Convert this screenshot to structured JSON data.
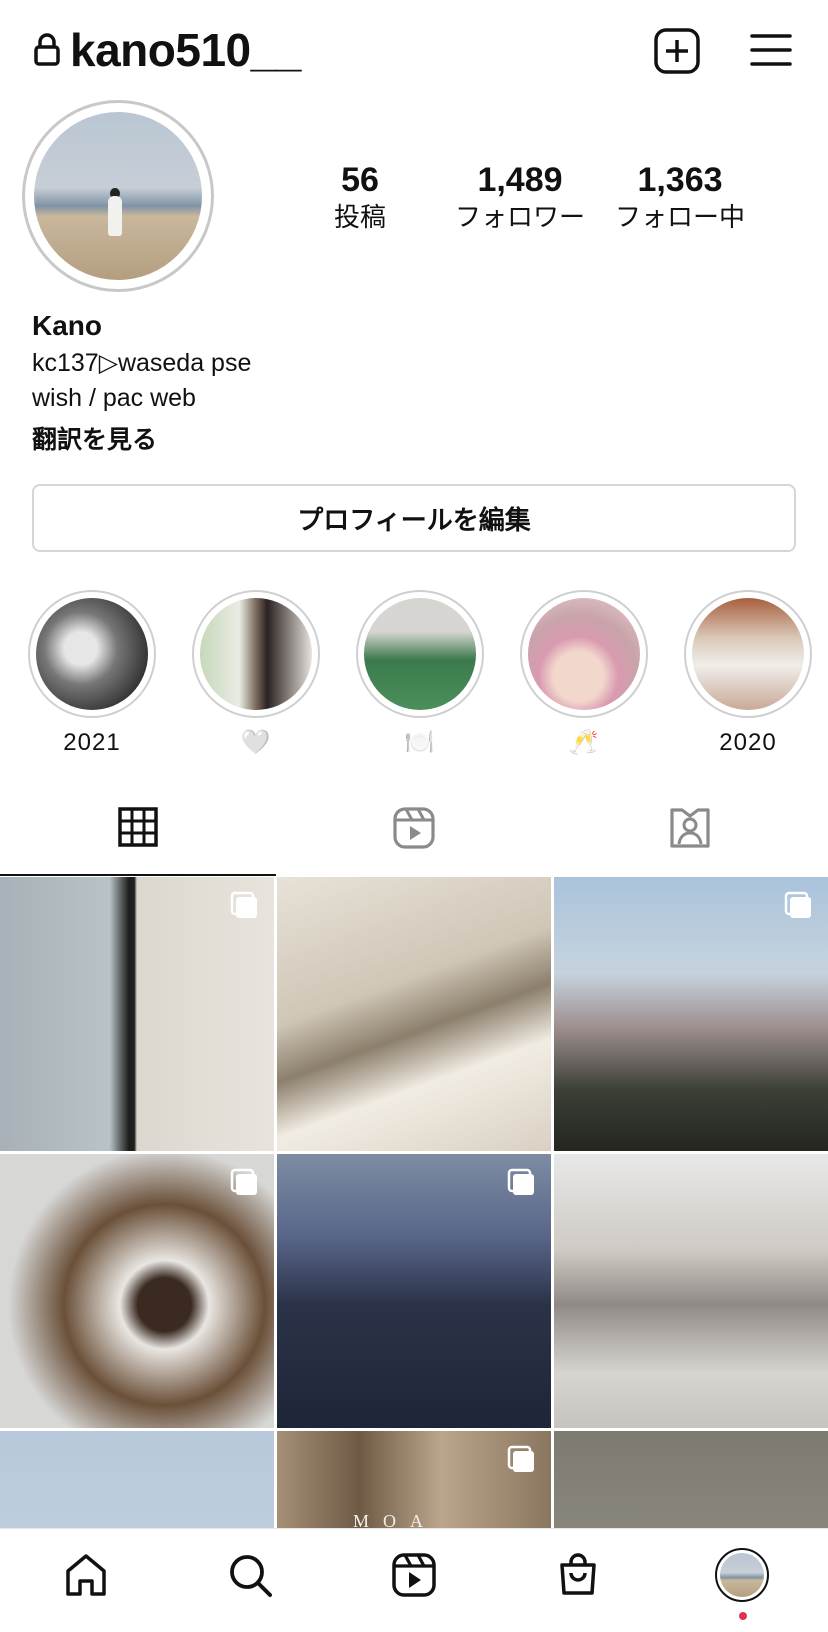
{
  "header": {
    "username": "kano510__",
    "icons": [
      "lock-icon",
      "add-post-icon",
      "menu-icon"
    ]
  },
  "profile": {
    "stats": [
      {
        "number": "56",
        "label": "投稿"
      },
      {
        "number": "1,489",
        "label": "フォロワー"
      },
      {
        "number": "1,363",
        "label": "フォロー中"
      }
    ],
    "name": "Kano",
    "bio_line1": "kc137▷waseda pse",
    "bio_line2": "wish / pac web",
    "translate_label": "翻訳を見る",
    "edit_button": "プロフィールを編集"
  },
  "highlights": [
    {
      "caption": "2021"
    },
    {
      "caption": "🤍"
    },
    {
      "caption": "🍽️"
    },
    {
      "caption": "🥂"
    },
    {
      "caption": "2020"
    }
  ],
  "tabs": [
    {
      "name": "grid",
      "icon": "grid-icon",
      "active": true
    },
    {
      "name": "reels",
      "icon": "reels-icon",
      "active": false
    },
    {
      "name": "tagged",
      "icon": "tagged-icon",
      "active": false
    }
  ],
  "posts": [
    {
      "multi": true
    },
    {
      "multi": false
    },
    {
      "multi": true
    },
    {
      "multi": true
    },
    {
      "multi": true
    },
    {
      "multi": false
    },
    {
      "multi": false
    },
    {
      "multi": true
    },
    {
      "multi": false
    }
  ],
  "post_overlay_text": "MOA MUSEI",
  "bottom_nav": [
    "home-icon",
    "search-icon",
    "reels-icon",
    "shop-icon",
    "profile-avatar"
  ],
  "colors": {
    "notification_dot": "#e0324c",
    "text": "#111111",
    "border": "#d6d6d6"
  }
}
